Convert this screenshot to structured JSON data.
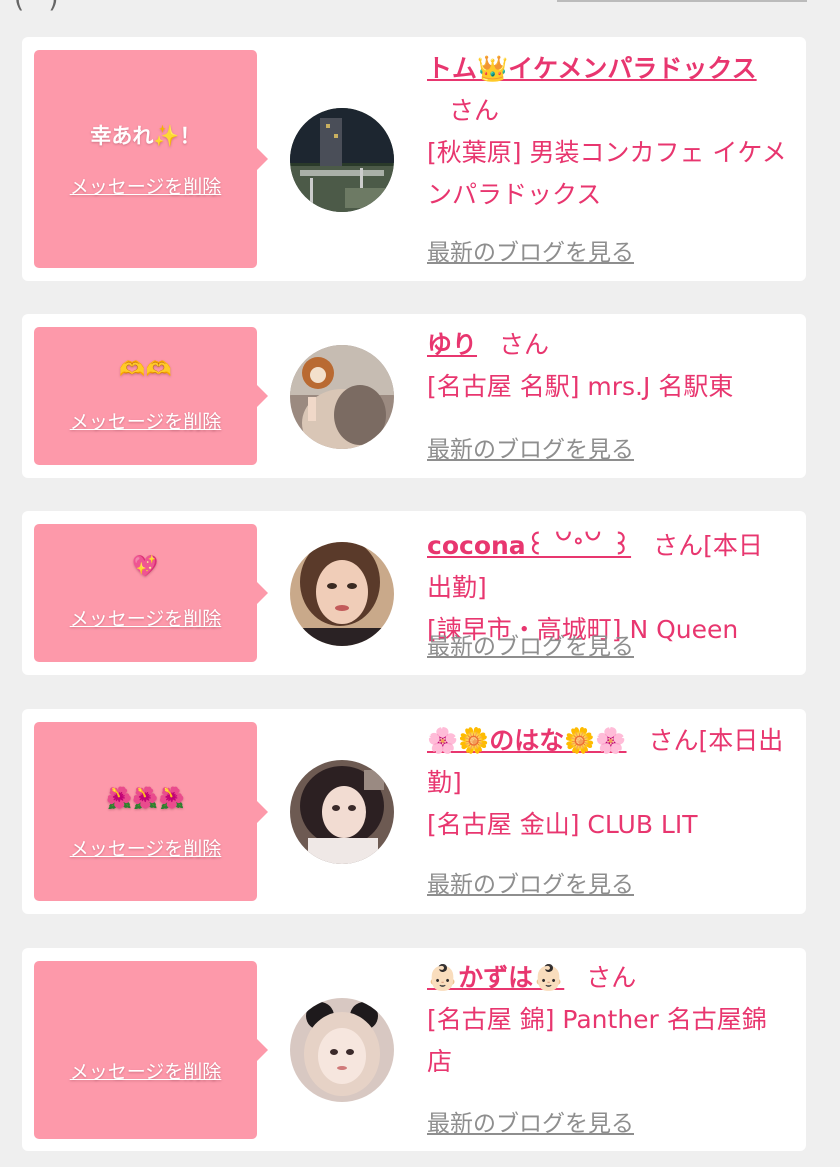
{
  "top": {
    "fragment": "( )"
  },
  "messages": [
    {
      "message": "幸あれ✨！",
      "delete_label": "メッセージを削除",
      "name": "トム👑イケメンパラドックス",
      "honorific": "さん",
      "status": "",
      "shop": "[秋葉原] 男装コンカフェ イケメンパラドックス",
      "blog_label": "最新のブログを見る"
    },
    {
      "message": "🫶🫶",
      "delete_label": "メッセージを削除",
      "name": "ゆり",
      "honorific": "さん",
      "status": "",
      "shop": "[名古屋 名駅] mrs.J 名駅東",
      "blog_label": "最新のブログを見る"
    },
    {
      "message": "💖",
      "delete_label": "メッセージを削除",
      "name": "cocona꒰ ꒡ᐤ꒡ ꒱",
      "honorific": "さん",
      "status": "[本日出勤]",
      "shop": "[諫早市・高城町] N Queen",
      "blog_label": "最新のブログを見る"
    },
    {
      "message": "🌺🌺🌺",
      "delete_label": "メッセージを削除",
      "name": "🌸🌼のはな🌼🌸",
      "honorific": "さん",
      "status": "[本日出勤]",
      "shop": "[名古屋 金山] CLUB LIT",
      "blog_label": "最新のブログを見る"
    },
    {
      "message": "",
      "delete_label": "メッセージを削除",
      "name": "👶🏻かずは👶🏻",
      "honorific": "さん",
      "status": "",
      "shop": "[名古屋 錦] Panther 名古屋錦店",
      "blog_label": "最新のブログを見る"
    }
  ]
}
